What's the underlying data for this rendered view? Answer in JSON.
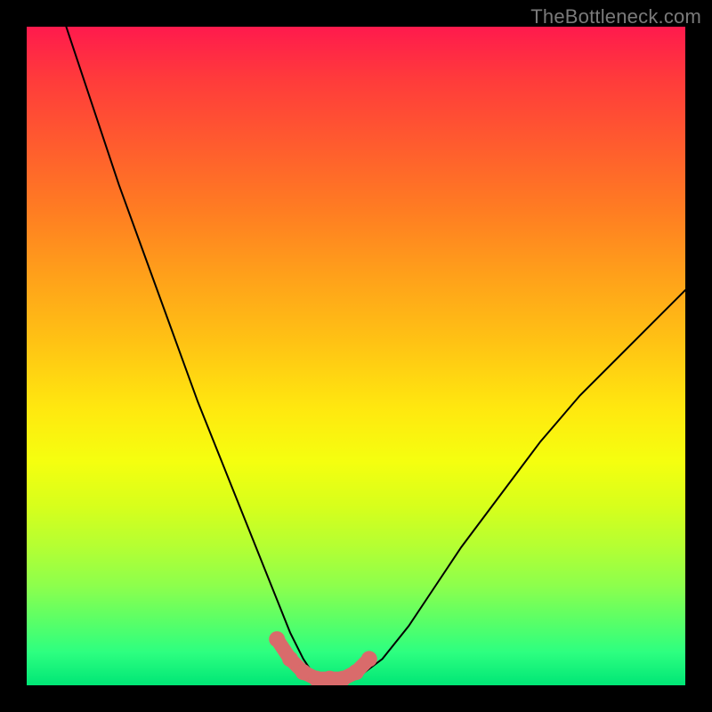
{
  "watermark": {
    "text": "TheBottleneck.com"
  },
  "chart_data": {
    "type": "line",
    "title": "",
    "xlabel": "",
    "ylabel": "",
    "xlim": [
      0,
      100
    ],
    "ylim": [
      0,
      100
    ],
    "series": [
      {
        "name": "bottleneck-curve",
        "x": [
          6,
          10,
          14,
          18,
          22,
          26,
          30,
          34,
          38,
          40,
          42,
          44,
          46,
          48,
          50,
          54,
          58,
          62,
          66,
          72,
          78,
          84,
          90,
          96,
          100
        ],
        "values": [
          100,
          88,
          76,
          65,
          54,
          43,
          33,
          23,
          13,
          8,
          4,
          1,
          0,
          0,
          1,
          4,
          9,
          15,
          21,
          29,
          37,
          44,
          50,
          56,
          60
        ]
      },
      {
        "name": "highlight-segment",
        "x": [
          38,
          40,
          42,
          44,
          46,
          48,
          50,
          52
        ],
        "values": [
          7,
          4,
          2,
          1,
          1,
          1,
          2,
          4
        ]
      }
    ],
    "colors": {
      "curve": "#000000",
      "highlight": "#d96b6b"
    }
  }
}
